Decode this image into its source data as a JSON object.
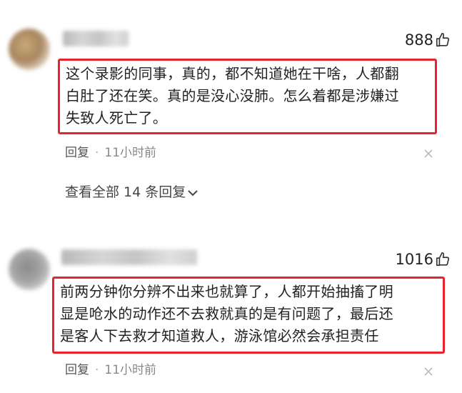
{
  "comments": [
    {
      "likes": "888",
      "text_lines": [
        "这个录影的同事，真的，都不知道她在干啥，人都翻",
        "白肚了还在笑。真的是没心没肺。怎么着都是涉嫌过",
        "失致人死亡了。"
      ],
      "reply_label": "回复",
      "separator": "·",
      "time": "11小时前",
      "view_replies": "查看全部 14 条回复"
    },
    {
      "likes": "1016",
      "text_lines": [
        "前两分钟你分辨不出来也就算了，人都开始抽搐了明",
        "显是呛水的动作还不去救就真的是有问题了，最后还",
        "是客人下去救才知道救人，游泳馆必然会承担责任"
      ],
      "reply_label": "回复",
      "separator": "·",
      "time": "11小时前"
    }
  ],
  "colors": {
    "highlight_border": "#e8242f",
    "meta_text": "#888888"
  },
  "icons": [
    "thumbs-up-icon",
    "close-icon",
    "chevron-down-icon"
  ]
}
